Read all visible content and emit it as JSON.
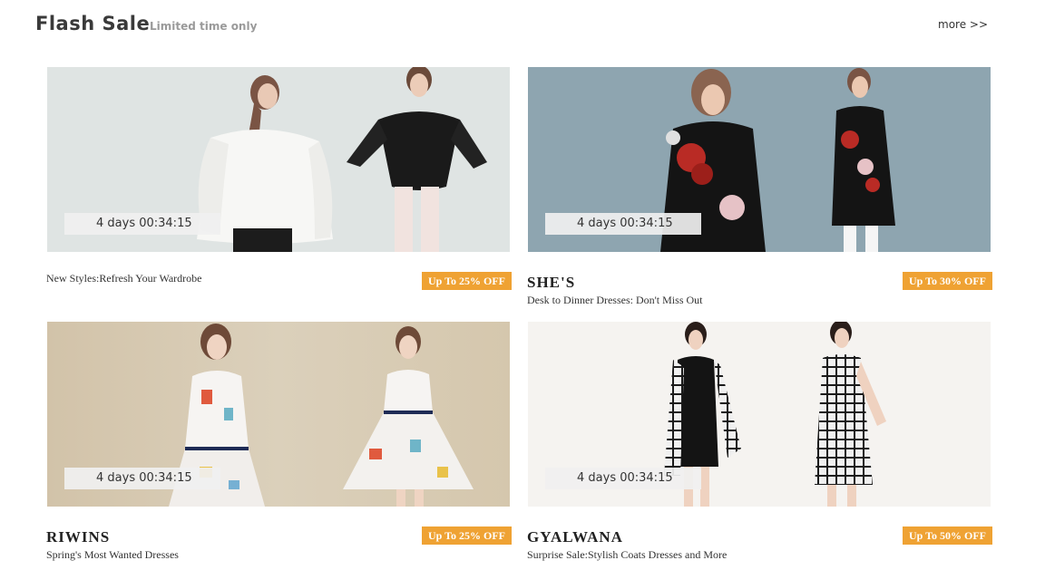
{
  "header": {
    "title": "Flash Sale",
    "subtitle": "Limited time only",
    "more_label": "more >>"
  },
  "cards": [
    {
      "timer": "4 days 00:34:15",
      "brand": "",
      "description": "New Styles:Refresh Your Wardrobe",
      "badge": "Up To 25% OFF",
      "bg_color": "#dde2e2"
    },
    {
      "timer": "4 days 00:34:15",
      "brand": "SHE'S",
      "description": "Desk to Dinner Dresses: Don't Miss Out",
      "badge": "Up To 30% OFF",
      "bg_color": "#8fa6b1"
    },
    {
      "timer": "4 days 00:34:15",
      "brand": "RIWINS",
      "description": "Spring's Most Wanted Dresses",
      "badge": "Up To 25% OFF",
      "bg_color": "#d8cbb2"
    },
    {
      "timer": "4 days 00:34:15",
      "brand": "GYALWANA",
      "description": "Surprise Sale:Stylish Coats Dresses and More",
      "badge": "Up To 50% OFF",
      "bg_color": "#f4f2ef"
    }
  ],
  "colors": {
    "badge": "#efa233",
    "title": "#3a3a3a",
    "subtitle": "#9a9a9a"
  }
}
